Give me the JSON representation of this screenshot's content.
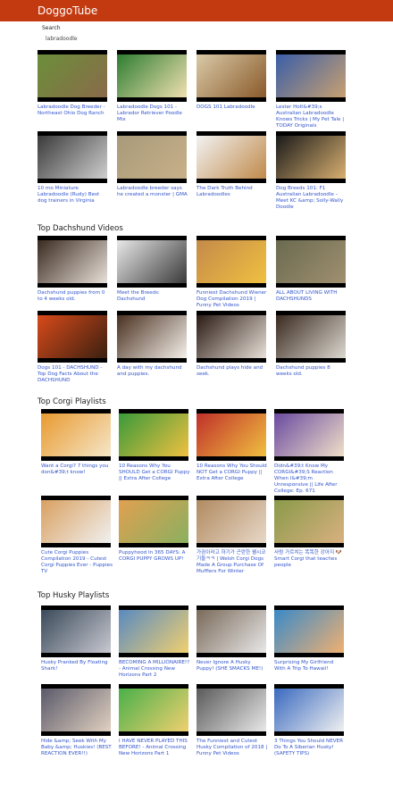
{
  "app": {
    "brand": "DoggoTube"
  },
  "search": {
    "label": "Search",
    "value": "labradoodle"
  },
  "sections": [
    {
      "title": "",
      "videos": [
        {
          "title": "Labradoodle Dog Breeder - Northeast Ohio Dog Ranch",
          "colors": [
            "#6b8f3a",
            "#8a6a4a"
          ]
        },
        {
          "title": "Labradoodle Dogs 101 - Labrador Retriever Poodle Mix",
          "colors": [
            "#2e7d32",
            "#f0e0b0"
          ]
        },
        {
          "title": "DOGS 101 Labradoodle",
          "colors": [
            "#d9c9a8",
            "#8a5a2a"
          ]
        },
        {
          "title": "Lester Holt&#39;s Australian Labradoodle Knows Tricks | My Pet Tale | TODAY Originals",
          "colors": [
            "#3a5ea8",
            "#c8a070"
          ]
        },
        {
          "title": "10 mo Miniature Labradoodle (Rudy) Best dog trainers in Virginia",
          "colors": [
            "#3a3a3a",
            "#cfcfcf"
          ]
        },
        {
          "title": "Labradoodle breeder says he created a monster | GMA",
          "colors": [
            "#a89a7a",
            "#c8b089"
          ]
        },
        {
          "title": "The Dark Truth Behind Labradoodles",
          "colors": [
            "#f2f2f2",
            "#c08a4a"
          ]
        },
        {
          "title": "Dog Breeds 101: F1 Australian Labradoodle – Meet KC &amp; Solly-Wally Doodle",
          "colors": [
            "#1a1a1a",
            "#d9b070"
          ]
        }
      ]
    },
    {
      "title": "Top Dachshund Videos",
      "videos": [
        {
          "title": "Dachshund puppies from 0 to 4 weeks old.",
          "colors": [
            "#3a2a20",
            "#e8e0d8"
          ]
        },
        {
          "title": "Meet the Breeds: Dachshund",
          "colors": [
            "#e8e8e8",
            "#3a3a3a"
          ]
        },
        {
          "title": "Funniest Dachshund Wiener Dog Compilation 2019 | Funny Pet Videos",
          "colors": [
            "#c48a4a",
            "#f0c040"
          ]
        },
        {
          "title": "ALL ABOUT LIVING WITH DACHSHUNDS",
          "colors": [
            "#6a6a50",
            "#a09070"
          ]
        },
        {
          "title": "Dogs 101 - DACHSHUND - Top Dog Facts About the DACHSHUND",
          "colors": [
            "#d84a1a",
            "#3a2010"
          ]
        },
        {
          "title": "A day with my dachshund and puppies.",
          "colors": [
            "#4a3020",
            "#f4f0ea"
          ]
        },
        {
          "title": "Dachshund plays hide and seek.",
          "colors": [
            "#2a1a14",
            "#e8e0d8"
          ]
        },
        {
          "title": "Dachshund puppies 8 weeks old.",
          "colors": [
            "#3a2a20",
            "#dcd8d0"
          ]
        }
      ]
    },
    {
      "title": "Top Corgi Playlists",
      "videos": [
        {
          "title": "Want a Corgi? 7 things you don&#39;t know!",
          "colors": [
            "#e89a30",
            "#f5e6c8"
          ]
        },
        {
          "title": "10 Reasons Why You SHOULD Get a CORGI Puppy || Extra After College",
          "colors": [
            "#3a9a3a",
            "#f0c040"
          ]
        },
        {
          "title": "10 Reasons Why You Should NOT Get a CORGI Puppy || Extra After College",
          "colors": [
            "#c0302a",
            "#f0c040"
          ]
        },
        {
          "title": "Didn&#39;t Know My CORGI&#39;S Reaction When I&#39;m Unresponsive || Life After College: Ep. 671",
          "colors": [
            "#6a4aa0",
            "#f0e0c8"
          ]
        },
        {
          "title": "Cute Corgi Puppies Compilation 2019 - Cutest Corgi Puppies Ever - Puppies TV",
          "colors": [
            "#d9a060",
            "#f0f0f0"
          ]
        },
        {
          "title": "Puppyhood In 365 DAYS: A CORGI PUPPY GROWS UP!",
          "colors": [
            "#e0a050",
            "#8ab060"
          ]
        },
        {
          "title": "가끔이라고 하기가 곤란한 웰시코기들ㅋㅋ | Welsh Corgi Dogs Made A Group Purchase Of Mufflers For Winter",
          "colors": [
            "#b08a60",
            "#e8d8c8"
          ]
        },
        {
          "title": "사람 가르치는 똑똑한 강아지 🐶 Smart Corgi that teaches people",
          "colors": [
            "#8a9a4a",
            "#d9b080"
          ]
        }
      ]
    },
    {
      "title": "Top Husky Playlists",
      "videos": [
        {
          "title": "Husky Pranked By Floating Shark!",
          "colors": [
            "#3a4a5a",
            "#c8c8d0"
          ]
        },
        {
          "title": "BECOMING A MILLIONAIRE!? - Animal Crossing New Horizons Part 2",
          "colors": [
            "#5a8ac0",
            "#f0d070"
          ]
        },
        {
          "title": "Never Ignore A Husky Puppy! (SHE SMACKS ME!)",
          "colors": [
            "#7a6a5a",
            "#e8e8e8"
          ]
        },
        {
          "title": "Surprising My Girlfriend With A Trip To Hawaii!",
          "colors": [
            "#3a8ac8",
            "#f0b070"
          ]
        },
        {
          "title": "Hide &amp; Seek With My Baby &amp; Huskies! (BEST REACTION EVER!!)",
          "colors": [
            "#5a5a6a",
            "#e0d0c0"
          ]
        },
        {
          "title": "I HAVE NEVER PLAYED THIS BEFORE! - Animal Crossing New Horizons Part 1",
          "colors": [
            "#4ab04a",
            "#f0d070"
          ]
        },
        {
          "title": "The Funniest and Cutest Husky Compilation of 2018 | Funny Pet Videos",
          "colors": [
            "#5a5a5a",
            "#e8e8e8"
          ]
        },
        {
          "title": "3 Things You Should NEVER Do To A Siberian Husky! (SAFETY TIPS)",
          "colors": [
            "#3a6ac0",
            "#f0f0f0"
          ]
        }
      ]
    }
  ]
}
